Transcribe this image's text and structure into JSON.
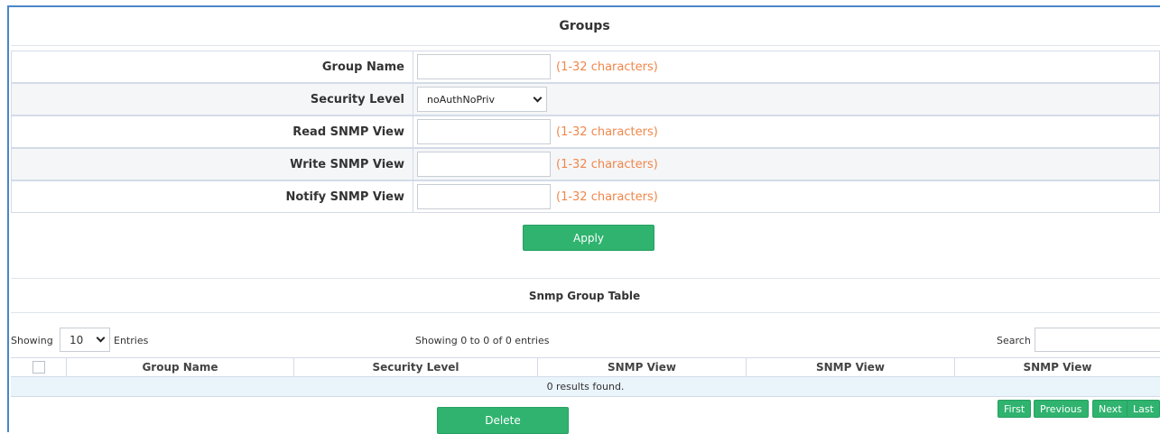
{
  "groups_form": {
    "title": "Groups",
    "fields": [
      {
        "label": "Group Name",
        "value": "",
        "hint": "(1-32 characters)"
      },
      {
        "label": "Security Level",
        "selected": "noAuthNoPriv"
      },
      {
        "label": "Read SNMP View",
        "value": "",
        "hint": "(1-32 characters)"
      },
      {
        "label": "Write SNMP View",
        "value": "",
        "hint": "(1-32 characters)"
      },
      {
        "label": "Notify SNMP View",
        "value": "",
        "hint": "(1-32 characters)"
      }
    ],
    "apply_label": "Apply"
  },
  "group_table": {
    "title": "Snmp Group Table",
    "showing_label": "Showing",
    "entries_value": "10",
    "entries_label": "Entries",
    "info": "Showing 0 to 0 of 0 entries",
    "search_label": "Search",
    "search_value": "",
    "columns": [
      "Group Name",
      "Security Level",
      "SNMP View",
      "SNMP View",
      "SNMP View"
    ],
    "empty_text": "0 results found.",
    "delete_label": "Delete",
    "pager": {
      "first": "First",
      "previous": "Previous",
      "next": "Next",
      "last": "Last"
    }
  },
  "colors": {
    "accent_green": "#2fb36f",
    "hint_orange": "#f0864a",
    "frame_blue": "#4a86c8"
  }
}
